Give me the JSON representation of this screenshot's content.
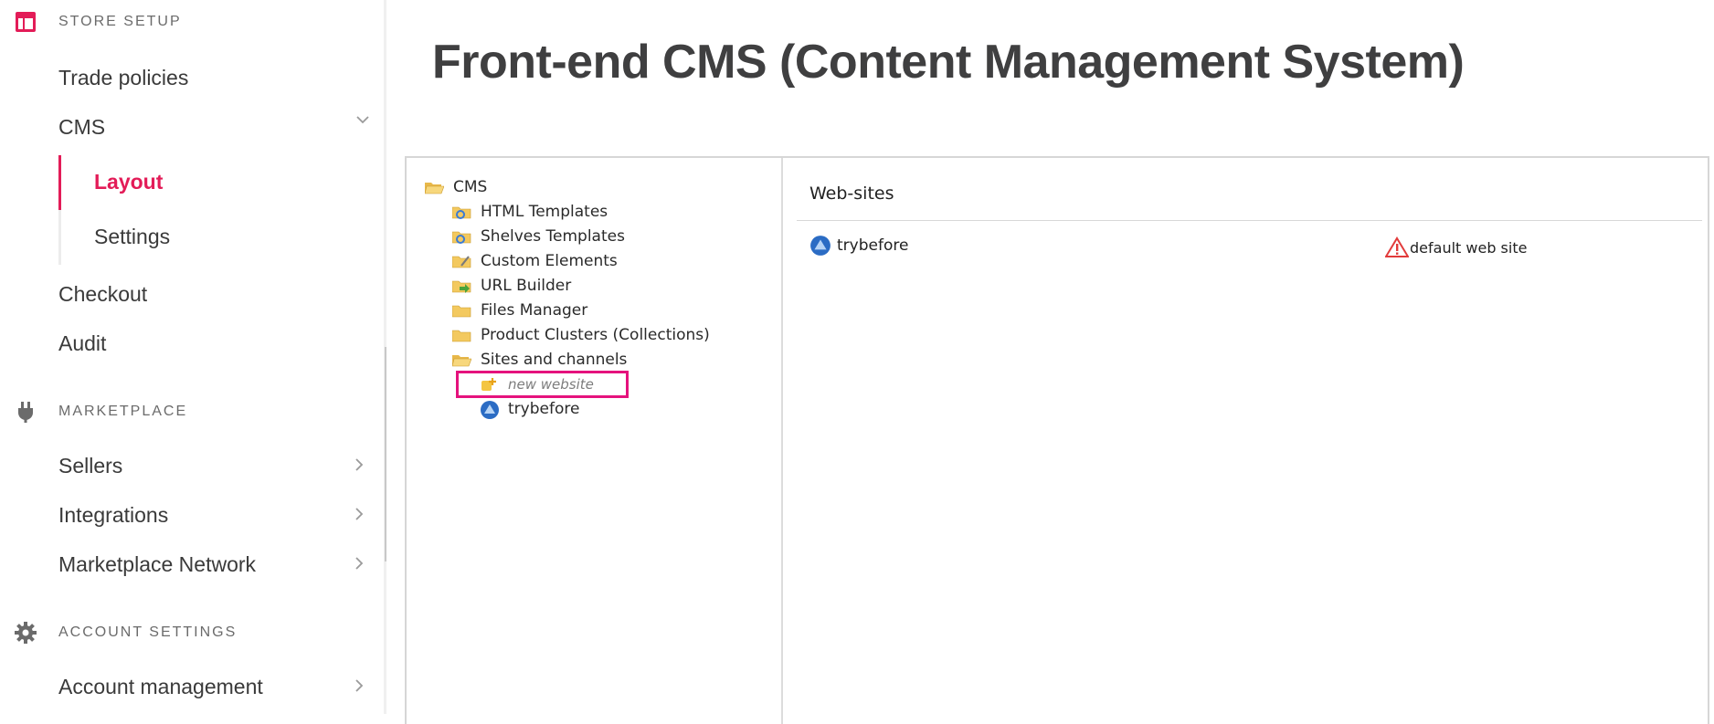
{
  "sidebar": {
    "store_setup": {
      "heading": "STORE SETUP",
      "icon": "layout-grid-icon",
      "items": {
        "trade_policies": "Trade policies",
        "cms": "CMS",
        "layout": "Layout",
        "settings": "Settings",
        "checkout": "Checkout",
        "audit": "Audit"
      }
    },
    "marketplace": {
      "heading": "MARKETPLACE",
      "icon": "plug-icon",
      "items": {
        "sellers": "Sellers",
        "integrations": "Integrations",
        "marketplace_network": "Marketplace Network"
      }
    },
    "account_settings": {
      "heading": "ACCOUNT SETTINGS",
      "icon": "gear-icon",
      "items": {
        "account_management": "Account management"
      }
    },
    "active_item": "Layout",
    "accent_color": "#e31c58"
  },
  "main": {
    "title": "Front-end CMS (Content Management System)",
    "tree": {
      "root": "CMS",
      "children": [
        "HTML Templates",
        "Shelves Templates",
        "Custom Elements",
        "URL Builder",
        "Files Manager",
        "Product Clusters (Collections)",
        "Sites and channels"
      ],
      "sites": {
        "new_website": "new website",
        "site": "trybefore"
      }
    },
    "websites_panel": {
      "heading": "Web-sites",
      "row": {
        "name": "trybefore",
        "default_label": "default web site"
      }
    },
    "highlight_color": "#e5127d"
  }
}
